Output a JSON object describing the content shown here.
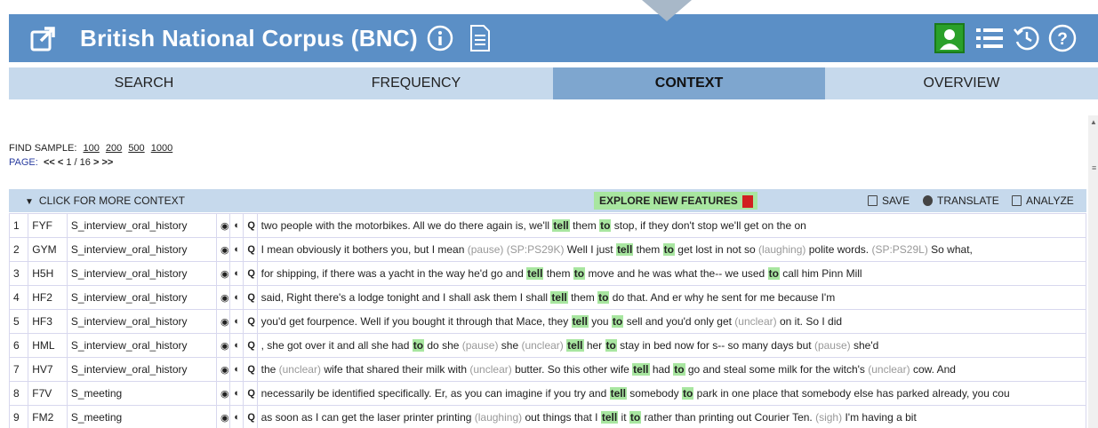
{
  "header": {
    "title": "British National Corpus (BNC)",
    "icons": [
      "external-link-icon",
      "info-icon",
      "document-icon",
      "user-icon",
      "list-icon",
      "history-icon",
      "help-icon"
    ]
  },
  "tabs": [
    {
      "label": "SEARCH",
      "active": false
    },
    {
      "label": "FREQUENCY",
      "active": false
    },
    {
      "label": "CONTEXT",
      "active": true
    },
    {
      "label": "OVERVIEW",
      "active": false
    }
  ],
  "sample": {
    "label": "FIND SAMPLE:",
    "options": [
      "100",
      "200",
      "500",
      "1000"
    ]
  },
  "page": {
    "label": "PAGE:",
    "first": "<<",
    "prev": "<",
    "current": "1 / 16",
    "next": ">",
    "last": ">>"
  },
  "context_bar": {
    "more": "CLICK FOR MORE CONTEXT",
    "explore": "EXPLORE NEW FEATURES",
    "save": "SAVE",
    "translate": "TRANSLATE",
    "analyze": "ANALYZE"
  },
  "rows": [
    {
      "num": "1",
      "code": "FYF",
      "genre": "S_interview_oral_history",
      "context": [
        [
          "two people with the motorbikes. All we do there again is, we'll ",
          ""
        ],
        [
          "tell",
          "kw"
        ],
        [
          " them ",
          ""
        ],
        [
          "to",
          "kw"
        ],
        [
          " stop, if they don't stop we'll get on the on",
          ""
        ]
      ]
    },
    {
      "num": "2",
      "code": "GYM",
      "genre": "S_interview_oral_history",
      "context": [
        [
          "I mean obviously it bothers you, but I mean ",
          ""
        ],
        [
          "(pause)",
          "gray"
        ],
        [
          " ",
          ""
        ],
        [
          "(SP:PS29K)",
          "gray"
        ],
        [
          " Well I just ",
          ""
        ],
        [
          "tell",
          "kw"
        ],
        [
          " them ",
          ""
        ],
        [
          "to",
          "kw"
        ],
        [
          " get lost in not so ",
          ""
        ],
        [
          "(laughing)",
          "gray"
        ],
        [
          " polite words. ",
          ""
        ],
        [
          "(SP:PS29L)",
          "gray"
        ],
        [
          " So what,",
          ""
        ]
      ]
    },
    {
      "num": "3",
      "code": "H5H",
      "genre": "S_interview_oral_history",
      "context": [
        [
          "for shipping, if there was a yacht in the way he'd go and ",
          ""
        ],
        [
          "tell",
          "kw"
        ],
        [
          " them ",
          ""
        ],
        [
          "to",
          "kw"
        ],
        [
          " move and he was what the-- we used ",
          ""
        ],
        [
          "to",
          "kw"
        ],
        [
          " call him Pinn Mill",
          ""
        ]
      ]
    },
    {
      "num": "4",
      "code": "HF2",
      "genre": "S_interview_oral_history",
      "context": [
        [
          "said, Right there's a lodge tonight and I shall ask them I shall ",
          ""
        ],
        [
          "tell",
          "kw"
        ],
        [
          " them ",
          ""
        ],
        [
          "to",
          "kw"
        ],
        [
          " do that. And er why he sent for me because I'm",
          ""
        ]
      ]
    },
    {
      "num": "5",
      "code": "HF3",
      "genre": "S_interview_oral_history",
      "context": [
        [
          "you'd get fourpence. Well if you bought it through that Mace, they ",
          ""
        ],
        [
          "tell",
          "kw"
        ],
        [
          " you ",
          ""
        ],
        [
          "to",
          "kw"
        ],
        [
          " sell and you'd only get ",
          ""
        ],
        [
          "(unclear)",
          "gray"
        ],
        [
          " on it. So I did",
          ""
        ]
      ]
    },
    {
      "num": "6",
      "code": "HML",
      "genre": "S_interview_oral_history",
      "context": [
        [
          ", she got over it and all she had ",
          ""
        ],
        [
          "to",
          "kw"
        ],
        [
          " do she ",
          ""
        ],
        [
          "(pause)",
          "gray"
        ],
        [
          " she ",
          ""
        ],
        [
          "(unclear)",
          "gray"
        ],
        [
          " ",
          ""
        ],
        [
          "tell",
          "kw"
        ],
        [
          " her ",
          ""
        ],
        [
          "to",
          "kw"
        ],
        [
          " stay in bed now for s-- so many days but ",
          ""
        ],
        [
          "(pause)",
          "gray"
        ],
        [
          " she'd",
          ""
        ]
      ]
    },
    {
      "num": "7",
      "code": "HV7",
      "genre": "S_interview_oral_history",
      "context": [
        [
          "the ",
          ""
        ],
        [
          "(unclear)",
          "gray"
        ],
        [
          " wife that shared their milk with ",
          ""
        ],
        [
          "(unclear)",
          "gray"
        ],
        [
          " butter. So this other wife ",
          ""
        ],
        [
          "tell",
          "kw"
        ],
        [
          " had ",
          ""
        ],
        [
          "to",
          "kw"
        ],
        [
          " go and steal some milk for the witch's ",
          ""
        ],
        [
          "(unclear)",
          "gray"
        ],
        [
          " cow. And",
          ""
        ]
      ]
    },
    {
      "num": "8",
      "code": "F7V",
      "genre": "S_meeting",
      "context": [
        [
          "necessarily be identified specifically. Er, as you can imagine if you try and ",
          ""
        ],
        [
          "tell",
          "kw"
        ],
        [
          " somebody ",
          ""
        ],
        [
          "to",
          "kw"
        ],
        [
          " park in one place that somebody else has parked already, you cou",
          ""
        ]
      ]
    },
    {
      "num": "9",
      "code": "FM2",
      "genre": "S_meeting",
      "context": [
        [
          "as soon as I can get the laser printer printing ",
          ""
        ],
        [
          "(laughing)",
          "gray"
        ],
        [
          " out things that I ",
          ""
        ],
        [
          "tell",
          "kw"
        ],
        [
          " it ",
          ""
        ],
        [
          "to",
          "kw"
        ],
        [
          " rather than printing out Courier Ten. ",
          ""
        ],
        [
          "(sigh)",
          "gray"
        ],
        [
          " I'm having a bit",
          ""
        ]
      ]
    }
  ]
}
